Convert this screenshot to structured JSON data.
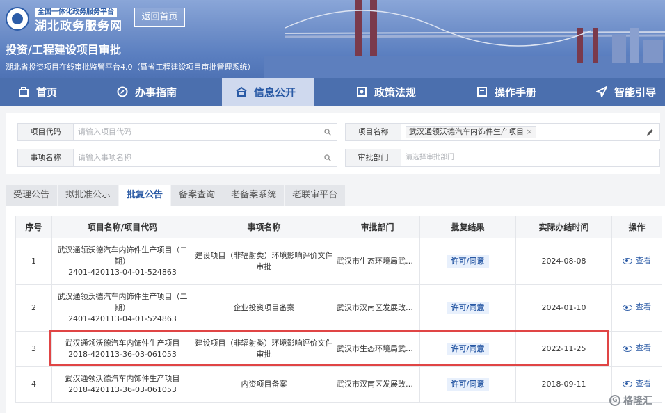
{
  "header": {
    "portal_small": "全国一体化政务服务平台",
    "portal_title": "湖北政务服务网",
    "home_button": "返回首页",
    "system_title": "投资/工程建设项目审批",
    "system_subtitle": "湖北省投资项目在线审批监管平台4.0（暨省工程建设项目审批管理系统）"
  },
  "nav": [
    {
      "label": "首页",
      "icon": "home-icon"
    },
    {
      "label": "办事指南",
      "icon": "compass-icon"
    },
    {
      "label": "信息公开",
      "icon": "info-icon",
      "active": true
    },
    {
      "label": "政策法规",
      "icon": "policy-icon"
    },
    {
      "label": "操作手册",
      "icon": "book-icon"
    },
    {
      "label": "智能引导",
      "icon": "navigate-icon"
    }
  ],
  "search": {
    "project_code": {
      "label": "项目代码",
      "placeholder": "请输入项目代码"
    },
    "project_name": {
      "label": "项目名称",
      "tag": "武汉通领沃德汽车内饰件生产项目"
    },
    "matter_name": {
      "label": "事项名称",
      "placeholder": "请输入事项名称"
    },
    "dept": {
      "label": "审批部门",
      "placeholder": "请选择审批部门"
    }
  },
  "tabs": [
    "受理公告",
    "拟批准公示",
    "批复公告",
    "备案查询",
    "老备案系统",
    "老联审平台"
  ],
  "active_tab": "批复公告",
  "table": {
    "columns": [
      "序号",
      "项目名称/项目代码",
      "事项名称",
      "审批部门",
      "批复结果",
      "实际办结时间",
      "操作"
    ],
    "rows": [
      {
        "no": "1",
        "project": "武汉通领沃德汽车内饰件生产项目（二期）",
        "code": "2401-420113-04-01-524863",
        "matter": "建设项目（非辐射类）环境影响评价文件审批",
        "dept": "武汉市生态环境局武汉...",
        "result": "许可/同意",
        "date": "2024-08-08",
        "action": "查看"
      },
      {
        "no": "2",
        "project": "武汉通领沃德汽车内饰件生产项目（二期）",
        "code": "2401-420113-04-01-524863",
        "matter": "企业投资项目备案",
        "dept": "武汉市汉南区发展改革...",
        "result": "许可/同意",
        "date": "2024-01-10",
        "action": "查看"
      },
      {
        "no": "3",
        "project": "武汉通领沃德汽车内饰件生产项目",
        "code": "2018-420113-36-03-061053",
        "matter": "建设项目（非辐射类）环境影响评价文件审批",
        "dept": "武汉市生态环境局武汉...",
        "result": "许可/同意",
        "date": "2022-11-25",
        "action": "查看"
      },
      {
        "no": "4",
        "project": "武汉通领沃德汽车内饰件生产项目",
        "code": "2018-420113-36-03-061053",
        "matter": "内资项目备案",
        "dept": "武汉市汉南区发展改革...",
        "result": "许可/同意",
        "date": "2018-09-11",
        "action": "查看"
      }
    ]
  },
  "watermark": "格隆汇"
}
